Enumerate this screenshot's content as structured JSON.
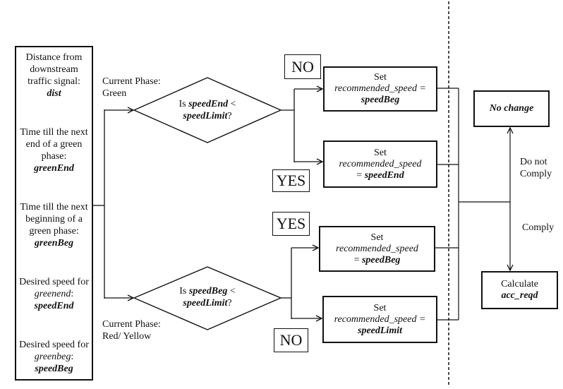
{
  "inputs_box": {
    "items": [
      {
        "text": "Distance from downstream traffic signal:",
        "var": "dist"
      },
      {
        "text": "Time till the next end of a green phase:",
        "var": "greenEnd"
      },
      {
        "text": "Time till the next beginning of a green phase:",
        "var": "greenBeg"
      },
      {
        "text_prefix": "Desired speed for ",
        "text_var": "greenend",
        "text_suffix": ":",
        "var": "speedEnd"
      },
      {
        "text_prefix": "Desired speed for ",
        "text_var": "greenbeg",
        "text_suffix": ":",
        "var": "speedBeg"
      }
    ]
  },
  "phases": {
    "green": {
      "line1": "Current Phase:",
      "line2": "Green"
    },
    "red_yellow": {
      "line1": "Current Phase:",
      "line2": "Red/ Yellow"
    }
  },
  "decisions": {
    "top": {
      "prefix": "Is ",
      "var1": "speedEnd",
      "op": " <",
      "var2": "speedLimit",
      "suffix": "?"
    },
    "bottom": {
      "prefix": "Is ",
      "var1": "speedBeg",
      "op": " <",
      "var2": "speedLimit",
      "suffix": "?"
    }
  },
  "branch_labels": {
    "top_no": "NO",
    "top_yes": "YES",
    "bottom_yes": "YES",
    "bottom_no": "NO"
  },
  "actions": [
    {
      "line1": "Set",
      "line2": "recommended_speed =",
      "line3_prefix": "",
      "line3_var": "speedBeg"
    },
    {
      "line1": "Set",
      "line2": "recommended_speed",
      "line3_prefix": "= ",
      "line3_var": "speedEnd"
    },
    {
      "line1": "Set",
      "line2": "recommended_speed",
      "line3_prefix": "= ",
      "line3_var": "speedBeg"
    },
    {
      "line1": "Set",
      "line2": "recommended_speed =",
      "line3_prefix": "",
      "line3_var": "speedLimit"
    }
  ],
  "outcomes": {
    "no_change": "No change",
    "calculate": {
      "line1": "Calculate",
      "line2": "acc_reqd"
    },
    "do_not_comply": {
      "line1": "Do not",
      "line2": "Comply"
    },
    "comply": "Comply"
  }
}
